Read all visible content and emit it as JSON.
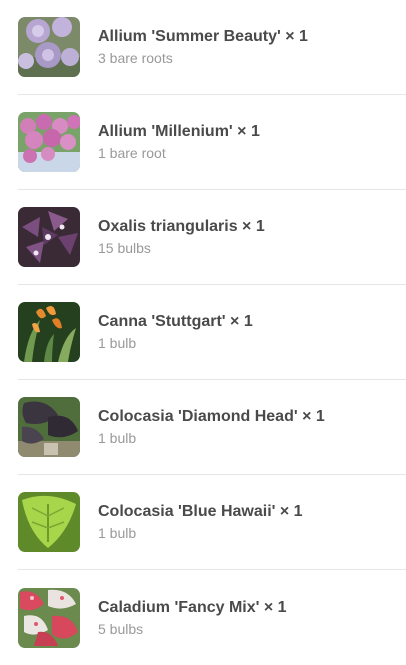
{
  "items": [
    {
      "title": "Allium 'Summer Beauty' × 1",
      "subtitle": "3 bare roots",
      "image": "allium-summer-beauty-photo"
    },
    {
      "title": "Allium 'Millenium' × 1",
      "subtitle": "1 bare root",
      "image": "allium-millenium-photo"
    },
    {
      "title": "Oxalis triangularis × 1",
      "subtitle": "15 bulbs",
      "image": "oxalis-triangularis-photo"
    },
    {
      "title": "Canna 'Stuttgart' × 1",
      "subtitle": "1 bulb",
      "image": "canna-stuttgart-photo"
    },
    {
      "title": "Colocasia 'Diamond Head' × 1",
      "subtitle": "1 bulb",
      "image": "colocasia-diamond-head-photo"
    },
    {
      "title": "Colocasia 'Blue Hawaii' × 1",
      "subtitle": "1 bulb",
      "image": "colocasia-blue-hawaii-photo"
    },
    {
      "title": "Caladium 'Fancy Mix' × 1",
      "subtitle": "5 bulbs",
      "image": "caladium-fancy-mix-photo"
    }
  ]
}
